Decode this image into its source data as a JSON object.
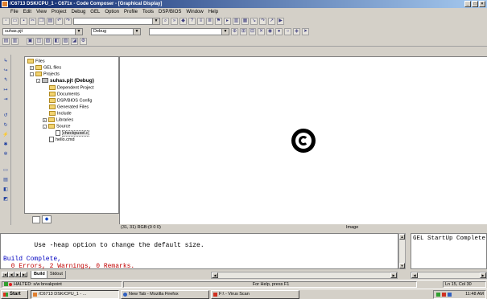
{
  "window": {
    "title": "/C6713 DSK/CPU_1 - C671x - Code Composer - [Graphical Display]"
  },
  "menu": [
    "File",
    "Edit",
    "View",
    "Project",
    "Debug",
    "GEL",
    "Option",
    "Profile",
    "Tools",
    "DSP/BIOS",
    "Window",
    "Help"
  ],
  "toolbar": {
    "project_combo": "suhas.pjt",
    "config_combo": "Debug"
  },
  "project_tree": {
    "files_label": "Files",
    "gel_files": "GEL files",
    "projects": "Projects",
    "project": "suhas.pjt (Debug)",
    "children": [
      "Dependent Project",
      "Documents",
      "DSP/BIOS Config",
      "Generated Files",
      "Include",
      "Libraries",
      "Source"
    ],
    "source_file": "checkpuxel.c",
    "cmd_file": "hello.cmd"
  },
  "graph": {
    "status_coords": "(31, 31) RGB:(0 0 0)",
    "status_mode": "Image"
  },
  "output": {
    "lines": [
      "        Use -heap option to change the default size.",
      "",
      "Build Complete,",
      "  0 Errors, 2 Warnings, 0 Remarks."
    ],
    "colors": {
      "normal": "#000000",
      "build": "#0000c0",
      "errors": "#c00000"
    }
  },
  "watch": {
    "text": "GEL StartUp Complete"
  },
  "tabs": {
    "build": "Build",
    "stdout": "Stdout"
  },
  "statusbar": {
    "halted": "HALTED: s/w breakpoint",
    "help": "For Help, press F1",
    "position": "Ln 15, Col 30"
  },
  "taskbar": {
    "start": "Start",
    "items": [
      "/C6713 DSK/CPU_1 - ...",
      "New Tab - Mozilla Firefox",
      "F:\\ - Virus Scan"
    ],
    "clock": "11:48 AM"
  }
}
